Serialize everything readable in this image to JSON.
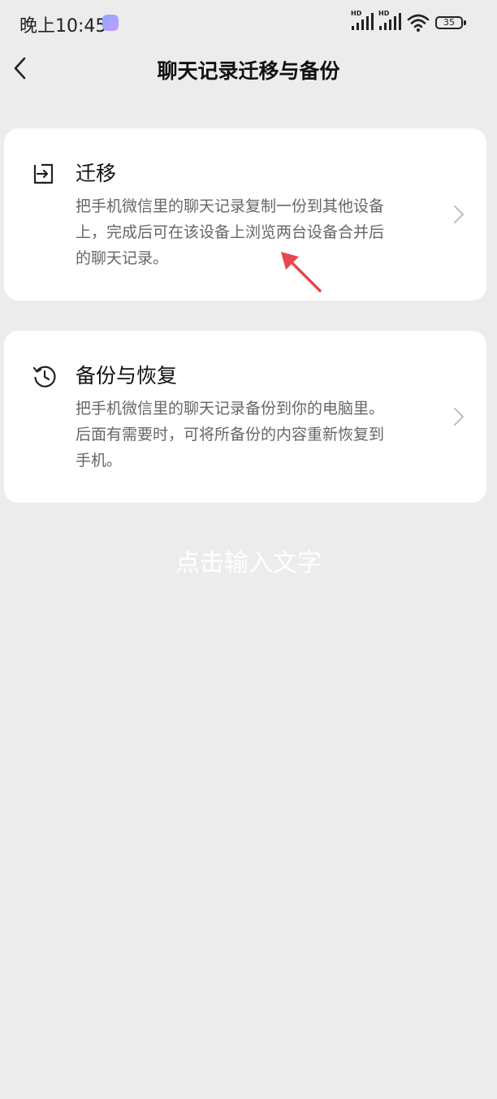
{
  "status_bar": {
    "time": "晚上10:45",
    "signal1_label": "HD",
    "signal2_label": "HD",
    "battery": "35"
  },
  "header": {
    "title": "聊天记录迁移与备份",
    "back_icon": "chevron-left-icon"
  },
  "cards": [
    {
      "title": "迁移",
      "description": "把手机微信里的聊天记录复制一份到其他设备上，完成后可在该设备上浏览两台设备合并后的聊天记录。",
      "icon": "migrate-icon"
    },
    {
      "title": "备份与恢复",
      "description": "把手机微信里的聊天记录备份到你的电脑里。后面有需要时，可将所备份的内容重新恢复到手机。",
      "icon": "history-clock-icon"
    }
  ],
  "overlay_text": "点击输入文字",
  "colors": {
    "background": "#ececec",
    "card": "#ffffff",
    "secondary_text": "#666666",
    "annotation_arrow": "#e5484d"
  }
}
